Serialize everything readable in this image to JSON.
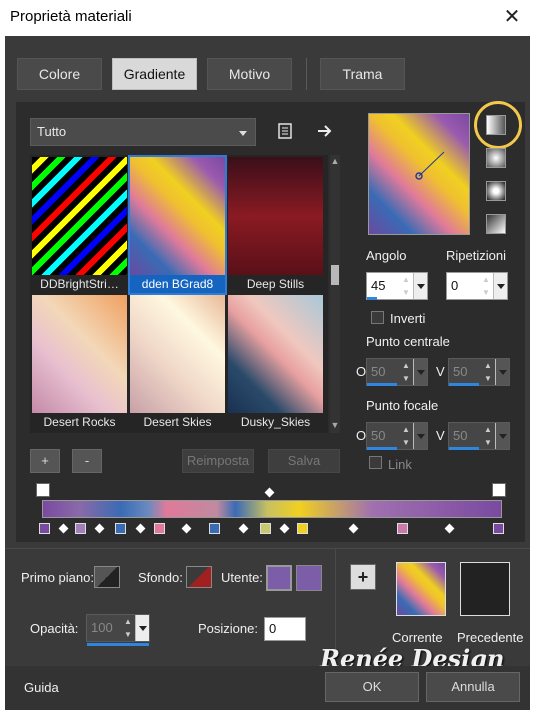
{
  "window": {
    "title": "Proprietà materiali",
    "close_icon": "close-icon"
  },
  "tabs": [
    {
      "label": "Colore",
      "active": false
    },
    {
      "label": "Gradiente",
      "active": true
    },
    {
      "label": "Motivo",
      "active": false
    },
    {
      "label": "Trama",
      "active": false
    }
  ],
  "library": {
    "category": "Tutto",
    "icons": [
      "document-icon",
      "arrow-right-icon"
    ],
    "gradients": [
      {
        "name": "DDBrightStri…",
        "selected": false
      },
      {
        "name": "dden BGrad8",
        "selected": true
      },
      {
        "name": "Deep Stills",
        "selected": false
      },
      {
        "name": "Desert Rocks",
        "selected": false
      },
      {
        "name": "Desert Skies",
        "selected": false
      },
      {
        "name": "Dusky_Skies",
        "selected": false
      }
    ],
    "add_label": "+",
    "remove_label": "-",
    "reset_label": "Reimposta",
    "save_label": "Salva"
  },
  "controls": {
    "angle_label": "Angolo",
    "angle_value": "45",
    "repeats_label": "Ripetizioni",
    "repeats_value": "0",
    "invert_label": "Inverti",
    "center_label": "Punto centrale",
    "focal_label": "Punto focale",
    "o_label": "O",
    "v_label": "V",
    "center_o": "50",
    "center_v": "50",
    "focal_o": "50",
    "focal_v": "50",
    "link_label": "Link"
  },
  "footer": {
    "foreground_label": "Primo piano:",
    "background_label": "Sfondo:",
    "user_label": "Utente:",
    "opacity_label": "Opacità:",
    "opacity_value": "100",
    "position_label": "Posizione:",
    "position_value": "0",
    "add_label": "+",
    "current_label": "Corrente",
    "previous_label": "Precedente",
    "help_label": "Guida",
    "ok_label": "OK",
    "cancel_label": "Annulla",
    "watermark": "Renée Design"
  },
  "colors": {
    "accent": "#2e86de",
    "highlight_ring": "#f2c94c",
    "user_swatch": "#7b5ea7"
  }
}
